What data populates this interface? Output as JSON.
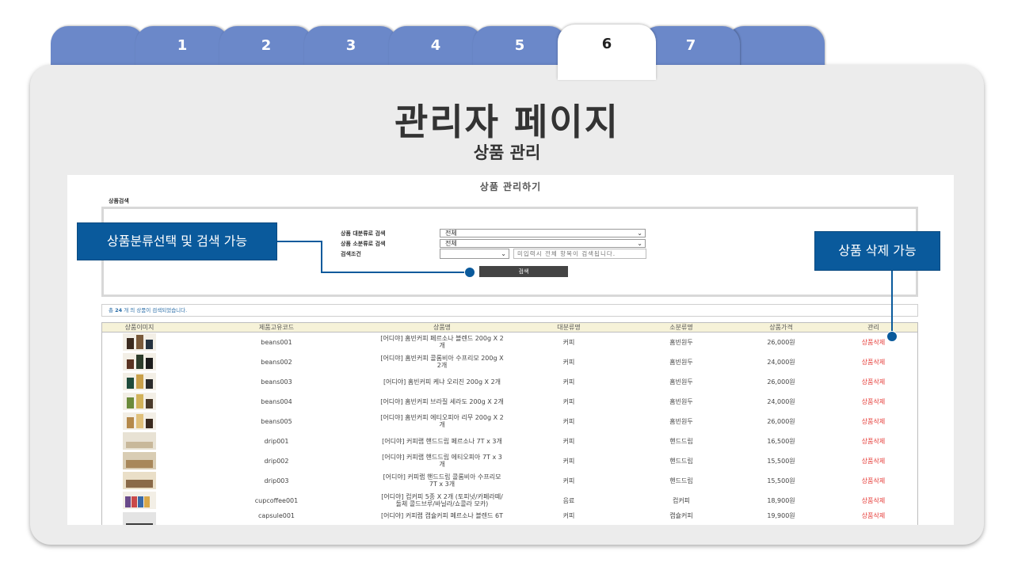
{
  "tabs": [
    "",
    "1",
    "2",
    "3",
    "4",
    "5",
    "6",
    "7",
    ""
  ],
  "active_tab": "6",
  "slide": {
    "title": "관리자 페이지",
    "subtitle": "상품 관리"
  },
  "screen": {
    "title": "상품 관리하기",
    "search_section_label": "상품검색",
    "filters": {
      "major_label": "상품 대분류로 검색",
      "major_value": "전체",
      "minor_label": "상품 소분류로 검색",
      "minor_value": "전체",
      "condition_label": "검색조건",
      "keyword_placeholder": "미입력시 전체 항목이 검색됩니다."
    },
    "search_button": "검색",
    "result_prefix": "총",
    "result_count": "24",
    "result_suffix": "개 의 상품이 검색되었습니다.",
    "columns": [
      "상품이미지",
      "제품고유코드",
      "상품명",
      "대분류명",
      "소분류명",
      "상품가격",
      "관리"
    ],
    "rows": [
      {
        "code": "beans001",
        "name": "[어디야] 홈빈커피 페르소나 블렌드 200g X 2개",
        "major": "커피",
        "minor": "홈빈원두",
        "price": "26,000원",
        "action": "상품삭제"
      },
      {
        "code": "beans002",
        "name": "[어디야] 홈빈커피 콜롬비아 수프리모 200g X 2개",
        "major": "커피",
        "minor": "홈빈원두",
        "price": "24,000원",
        "action": "상품삭제"
      },
      {
        "code": "beans003",
        "name": "[어디야] 홈빈커피 케냐 오리진 200g X 2개",
        "major": "커피",
        "minor": "홈빈원두",
        "price": "26,000원",
        "action": "상품삭제"
      },
      {
        "code": "beans004",
        "name": "[어디야] 홈빈커피 브라질 세라도 200g X 2개",
        "major": "커피",
        "minor": "홈빈원두",
        "price": "24,000원",
        "action": "상품삭제"
      },
      {
        "code": "beans005",
        "name": "[어디야] 홈빈커피 에티오피아 리무 200g X 2개",
        "major": "커피",
        "minor": "홈빈원두",
        "price": "26,000원",
        "action": "상품삭제"
      },
      {
        "code": "drip001",
        "name": "[어디야] 커피랩 핸드드립 페르소나 7T x 3개",
        "major": "커피",
        "minor": "핸드드립",
        "price": "16,500원",
        "action": "상품삭제"
      },
      {
        "code": "drip002",
        "name": "[어디야] 커피랩 핸드드립 에티오피아 7T x 3개",
        "major": "커피",
        "minor": "핸드드립",
        "price": "15,500원",
        "action": "상품삭제"
      },
      {
        "code": "drip003",
        "name": "[어디야] 커피랩 핸드드립 콜롬비아 수프리모 7T x 3개",
        "major": "커피",
        "minor": "핸드드립",
        "price": "15,500원",
        "action": "상품삭제"
      },
      {
        "code": "cupcoffee001",
        "name": "[어디야] 컵커피 5종 X 2개 (토피넛/카페라떼/돌체 콜드브루/바닐라/쇼콜라 모카)",
        "major": "음료",
        "minor": "컵커피",
        "price": "18,900원",
        "action": "상품삭제"
      },
      {
        "code": "capsule001",
        "name": "[어디야] 커피랩 캡슐커피 페르소나 블렌드 6T",
        "major": "커피",
        "minor": "캡슐커피",
        "price": "19,900원",
        "action": "상품삭제"
      }
    ]
  },
  "callouts": {
    "left": "상품분류선택 및 검색 가능",
    "right": "상품 삭제 가능"
  },
  "colors": {
    "tab_fill": "#6b88c9",
    "panel": "#ececec",
    "callout": "#0a5a9c",
    "delete_text": "#e53935",
    "table_header": "#f6f2d8"
  }
}
